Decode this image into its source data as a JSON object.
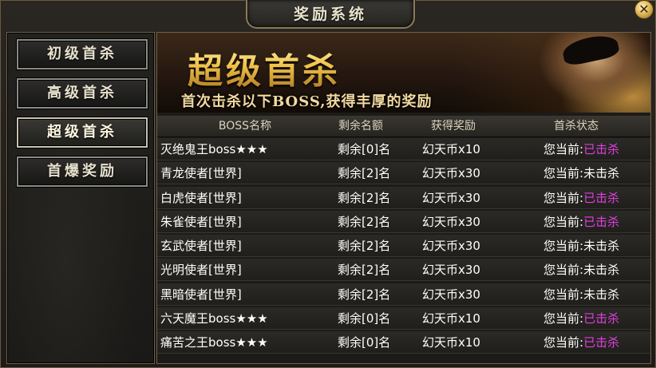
{
  "window": {
    "title": "奖励系统",
    "close_label": "✕"
  },
  "sidebar": {
    "items": [
      {
        "label": "初级首杀",
        "active": false
      },
      {
        "label": "高级首杀",
        "active": false
      },
      {
        "label": "超级首杀",
        "active": true
      },
      {
        "label": "首爆奖励",
        "active": false
      }
    ]
  },
  "banner": {
    "title": "超级首杀",
    "subtitle": "首次击杀以下BOSS,获得丰厚的奖励"
  },
  "table": {
    "headers": [
      "BOSS名称",
      "剩余名额",
      "获得奖励",
      "首杀状态"
    ],
    "status_prefix": "您当前:",
    "rows": [
      {
        "name": "灭绝鬼王boss★★★",
        "remaining": "剩余[0]名",
        "reward": "幻天币x10",
        "status": "已击杀",
        "killed": true
      },
      {
        "name": "青龙使者[世界]",
        "remaining": "剩余[2]名",
        "reward": "幻天币x30",
        "status": "未击杀",
        "killed": false
      },
      {
        "name": "白虎使者[世界]",
        "remaining": "剩余[2]名",
        "reward": "幻天币x30",
        "status": "已击杀",
        "killed": true
      },
      {
        "name": "朱雀使者[世界]",
        "remaining": "剩余[2]名",
        "reward": "幻天币x30",
        "status": "已击杀",
        "killed": true
      },
      {
        "name": "玄武使者[世界]",
        "remaining": "剩余[2]名",
        "reward": "幻天币x30",
        "status": "未击杀",
        "killed": false
      },
      {
        "name": "光明使者[世界]",
        "remaining": "剩余[2]名",
        "reward": "幻天币x30",
        "status": "未击杀",
        "killed": false
      },
      {
        "name": "黑暗使者[世界]",
        "remaining": "剩余[2]名",
        "reward": "幻天币x30",
        "status": "未击杀",
        "killed": false
      },
      {
        "name": "六天魔王boss★★★",
        "remaining": "剩余[0]名",
        "reward": "幻天币x10",
        "status": "已击杀",
        "killed": true
      },
      {
        "name": "痛苦之王boss★★★",
        "remaining": "剩余[0]名",
        "reward": "幻天币x10",
        "status": "已击杀",
        "killed": true
      }
    ]
  },
  "colors": {
    "killed": "#e040e0",
    "not_killed": "#ffffff",
    "accent_gold": "#f0c44a"
  }
}
